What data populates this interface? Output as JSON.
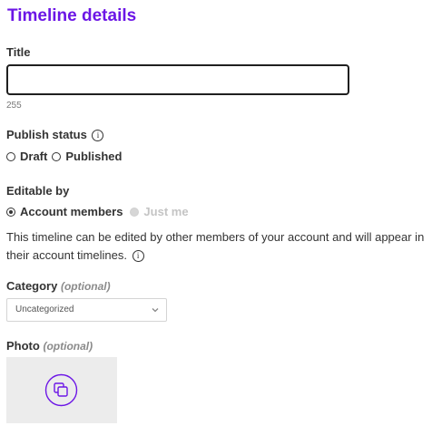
{
  "page": {
    "title": "Timeline details"
  },
  "title_field": {
    "label": "Title",
    "value": "",
    "placeholder": "",
    "char_count": "255"
  },
  "publish_status": {
    "label": "Publish status",
    "info_icon": "info-icon",
    "options": [
      {
        "label": "Draft",
        "selected": false
      },
      {
        "label": "Published",
        "selected": false
      }
    ]
  },
  "editable_by": {
    "label": "Editable by",
    "options": [
      {
        "label": "Account members",
        "selected": true,
        "disabled": false
      },
      {
        "label": "Just me",
        "selected": false,
        "disabled": true
      }
    ],
    "description": "This timeline can be edited by other members of your account and will appear in their account timelines."
  },
  "category": {
    "label": "Category",
    "optional_label": "(optional)",
    "selected": "Uncategorized",
    "dropdown_icon": "chevron-down-icon"
  },
  "photo": {
    "label": "Photo",
    "optional_label": "(optional)",
    "icon": "photo-upload-icon"
  },
  "colors": {
    "accent": "#6c16e6",
    "text": "#333333",
    "muted": "#8a8a8a",
    "disabled": "#c4c4c4",
    "photo_bg": "#ececec"
  }
}
